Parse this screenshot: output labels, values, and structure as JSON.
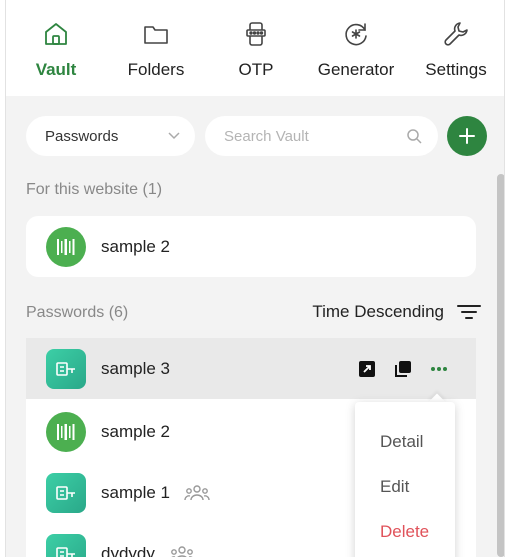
{
  "nav": {
    "items": [
      {
        "label": "Vault",
        "icon": "home-icon",
        "active": true
      },
      {
        "label": "Folders",
        "icon": "folder-icon",
        "active": false
      },
      {
        "label": "OTP",
        "icon": "phone-otp-icon",
        "active": false
      },
      {
        "label": "Generator",
        "icon": "generator-icon",
        "active": false
      },
      {
        "label": "Settings",
        "icon": "wrench-icon",
        "active": false
      }
    ]
  },
  "toolbar": {
    "type_select": "Passwords",
    "search_placeholder": "Search Vault",
    "add_icon": "plus-icon"
  },
  "website_section": {
    "title": "For this website (1)",
    "items": [
      {
        "name": "sample 2",
        "logo": "barcode-logo-icon"
      }
    ]
  },
  "passwords_section": {
    "title": "Passwords (6)",
    "sort_label": "Time Descending",
    "items": [
      {
        "name": "sample 3",
        "logo": "key-logo-icon",
        "shared": false
      },
      {
        "name": "sample 2",
        "logo": "barcode-logo-icon",
        "shared": false
      },
      {
        "name": "sample 1",
        "logo": "key-logo-icon",
        "shared": true
      },
      {
        "name": "dydydy",
        "logo": "key-logo-icon",
        "shared": true
      }
    ]
  },
  "context_menu": {
    "items": [
      "Detail",
      "Edit",
      "Delete"
    ]
  },
  "colors": {
    "accent": "#2e8540",
    "danger": "#e0525a",
    "background": "#f3f3f3"
  }
}
